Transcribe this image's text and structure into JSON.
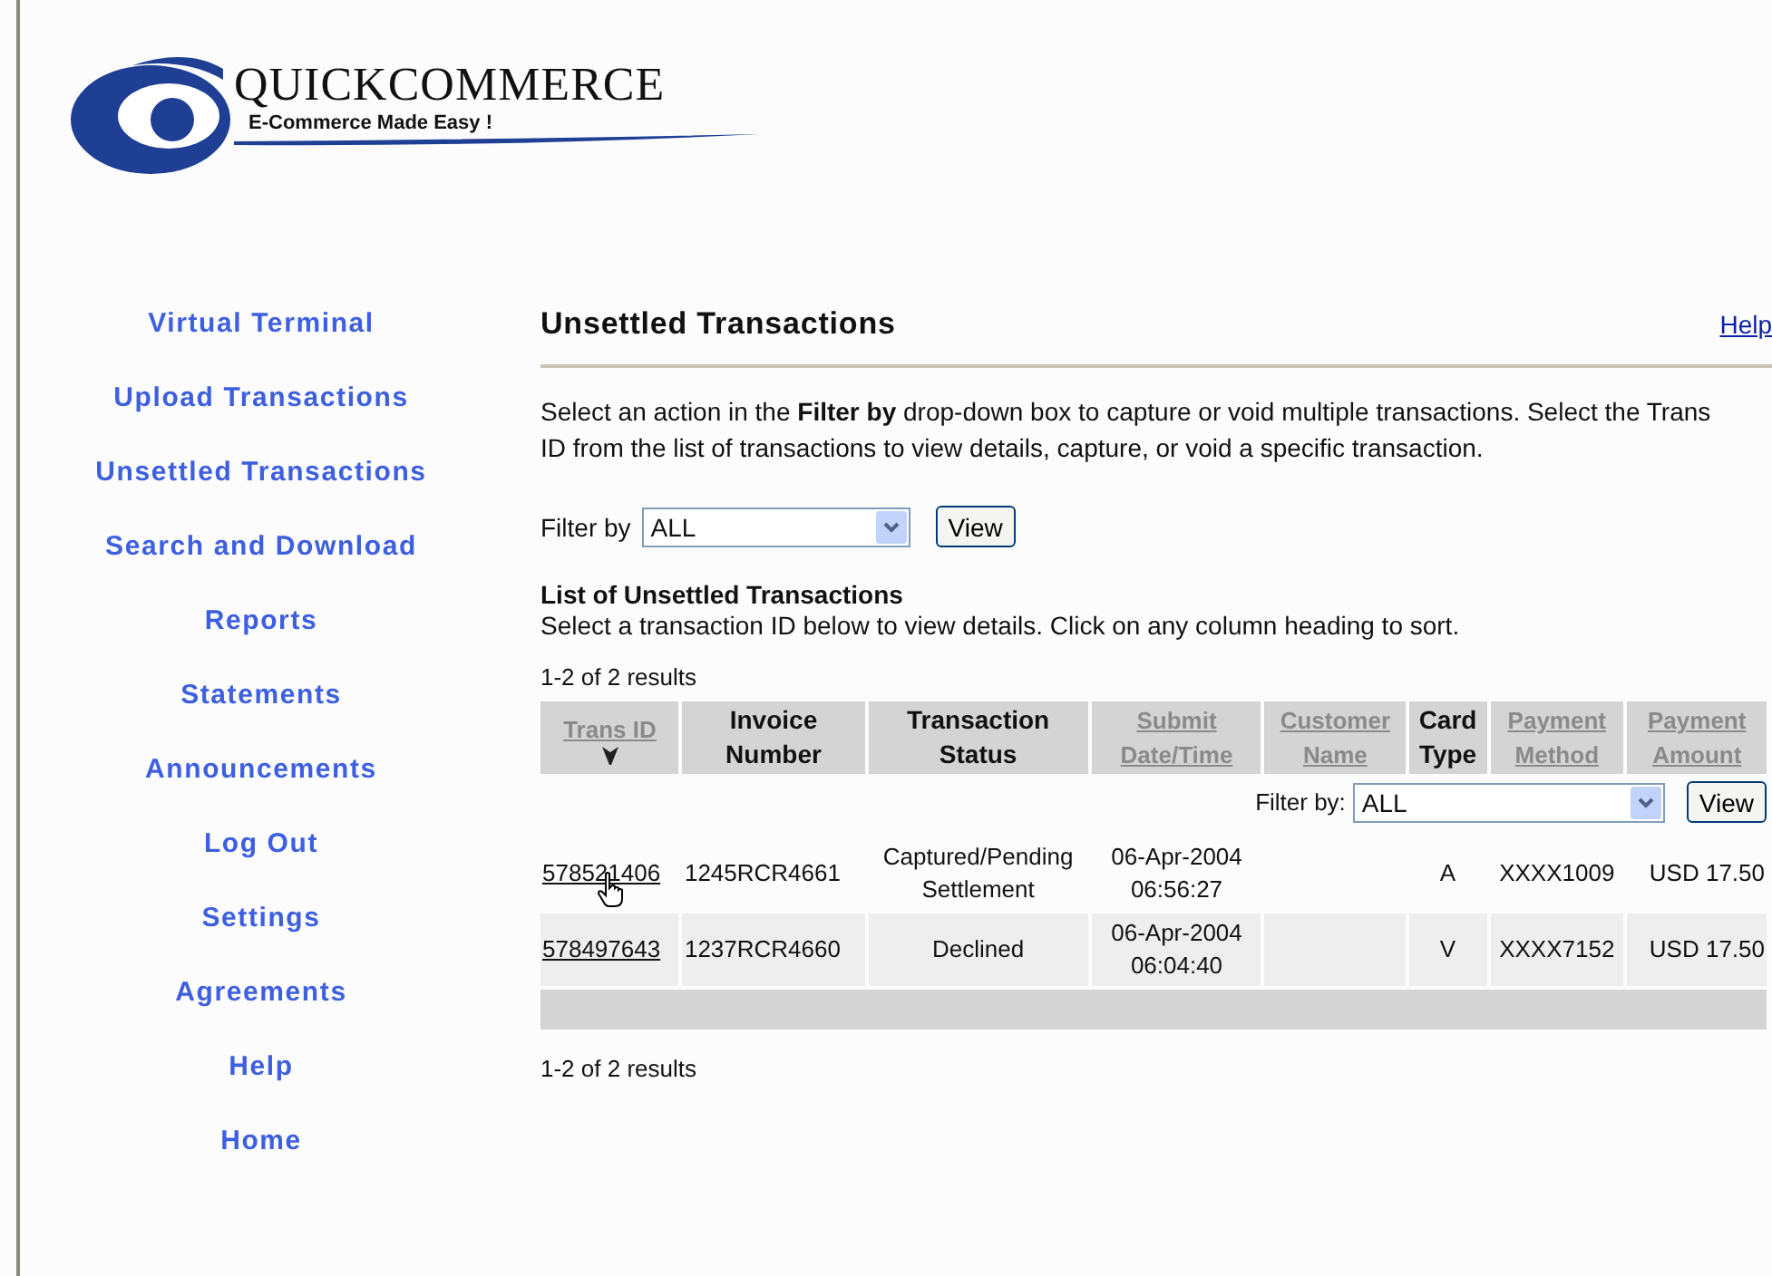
{
  "logo": {
    "name": "QUICKCOMMERCE",
    "tagline": "E-Commerce Made Easy !"
  },
  "sidebar": {
    "items": [
      {
        "label": "Virtual Terminal"
      },
      {
        "label": "Upload Transactions"
      },
      {
        "label": "Unsettled Transactions"
      },
      {
        "label": "Search and Download"
      },
      {
        "label": "Reports"
      },
      {
        "label": "Statements"
      },
      {
        "label": "Announcements"
      },
      {
        "label": "Log Out"
      },
      {
        "label": "Settings"
      },
      {
        "label": "Agreements"
      },
      {
        "label": "Help"
      },
      {
        "label": "Home"
      }
    ]
  },
  "page": {
    "title": "Unsettled Transactions",
    "help_link": "Help",
    "intro": "Select an action in the **Filter by** drop-down box to capture or void multiple transactions. Select the Trans ID from the list of transactions to view details, capture, or void a specific transaction.",
    "filter": {
      "label": "Filter by",
      "value": "ALL",
      "button": "View"
    },
    "list_title": "List of Unsettled Transactions",
    "list_hint": "Select a transaction ID below to view details. Click on any column heading to sort.",
    "results_top": "1-2 of 2 results",
    "results_bottom": "1-2 of 2 results"
  },
  "table": {
    "columns": [
      {
        "label": "Trans ID",
        "sortable": true,
        "sorted": true
      },
      {
        "label": "Invoice Number",
        "sortable": false,
        "sorted": false
      },
      {
        "label": "Transaction Status",
        "sortable": false,
        "sorted": false
      },
      {
        "label": "Submit Date/Time",
        "sortable": true,
        "sorted": false
      },
      {
        "label": "Customer Name",
        "sortable": true,
        "sorted": false
      },
      {
        "label": "Card Type",
        "sortable": false,
        "sorted": false
      },
      {
        "label": "Payment Method",
        "sortable": true,
        "sorted": false
      },
      {
        "label": "Payment Amount",
        "sortable": true,
        "sorted": false
      }
    ],
    "filter": {
      "label": "Filter by:",
      "value": "ALL",
      "button": "View"
    },
    "rows": [
      {
        "cells": [
          "578521406",
          "1245RCR4661",
          "Captured/Pending Settlement",
          "06-Apr-2004 06:56:27",
          "",
          "A",
          "XXXX1009",
          "USD 17.50"
        ],
        "hovered": true
      },
      {
        "cells": [
          "578497643",
          "1237RCR4660",
          "Declined",
          "06-Apr-2004 06:04:40",
          "",
          "V",
          "XXXX7152",
          "USD 17.50"
        ],
        "hovered": false
      }
    ]
  }
}
